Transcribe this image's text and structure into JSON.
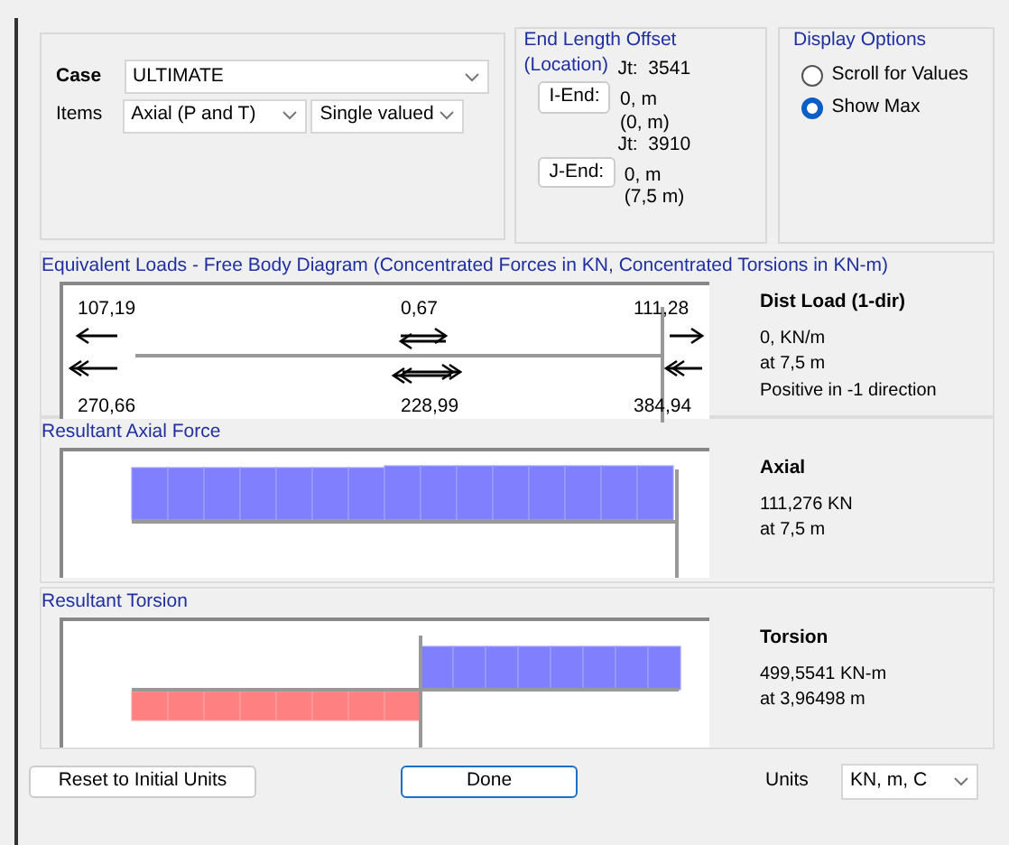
{
  "load_case": {
    "case_label": "Case",
    "case_value": "ULTIMATE",
    "items_label": "Items",
    "items_value": "Axial (P and T)",
    "items_mode": "Single valued"
  },
  "end_offset": {
    "title": "End Length Offset",
    "subtitle": "(Location)",
    "ends": [
      {
        "button": "I-End:",
        "joint": "Jt:  3541",
        "offset": "0, m",
        "location": "(0, m)"
      },
      {
        "button": "J-End:",
        "joint": "Jt:  3910",
        "offset": "0, m",
        "location": "(7,5 m)"
      }
    ]
  },
  "display_options": {
    "title": "Display Options",
    "options": [
      {
        "label": "Scroll for Values",
        "selected": false
      },
      {
        "label": "Show Max",
        "selected": true
      }
    ]
  },
  "free_body": {
    "title": "Equivalent Loads - Free Body Diagram  (Concentrated Forces in KN, Concentrated Torsions in KN-m)",
    "labels": [
      {
        "text": "107,19"
      },
      {
        "text": "0,67"
      },
      {
        "text": "111,28"
      },
      {
        "text": "270,66"
      },
      {
        "text": "228,99"
      },
      {
        "text": "384,94"
      }
    ],
    "info_title": "Dist Load (1-dir)",
    "info_lines": [
      "0, KN/m",
      "at 7,5 m",
      "Positive in -1 direction"
    ]
  },
  "axial": {
    "title": "Resultant Axial Force",
    "info_title": "Axial",
    "info_lines": [
      "111,276 KN",
      "at 7,5 m"
    ]
  },
  "torsion": {
    "title": "Resultant Torsion",
    "info_title": "Torsion",
    "info_lines": [
      "499,5541 KN-m",
      "at 3,96498 m"
    ]
  },
  "footer": {
    "reset_button": "Reset to Initial Units",
    "done_button": "Done",
    "units_label": "Units",
    "units_value": "KN, m, C"
  }
}
